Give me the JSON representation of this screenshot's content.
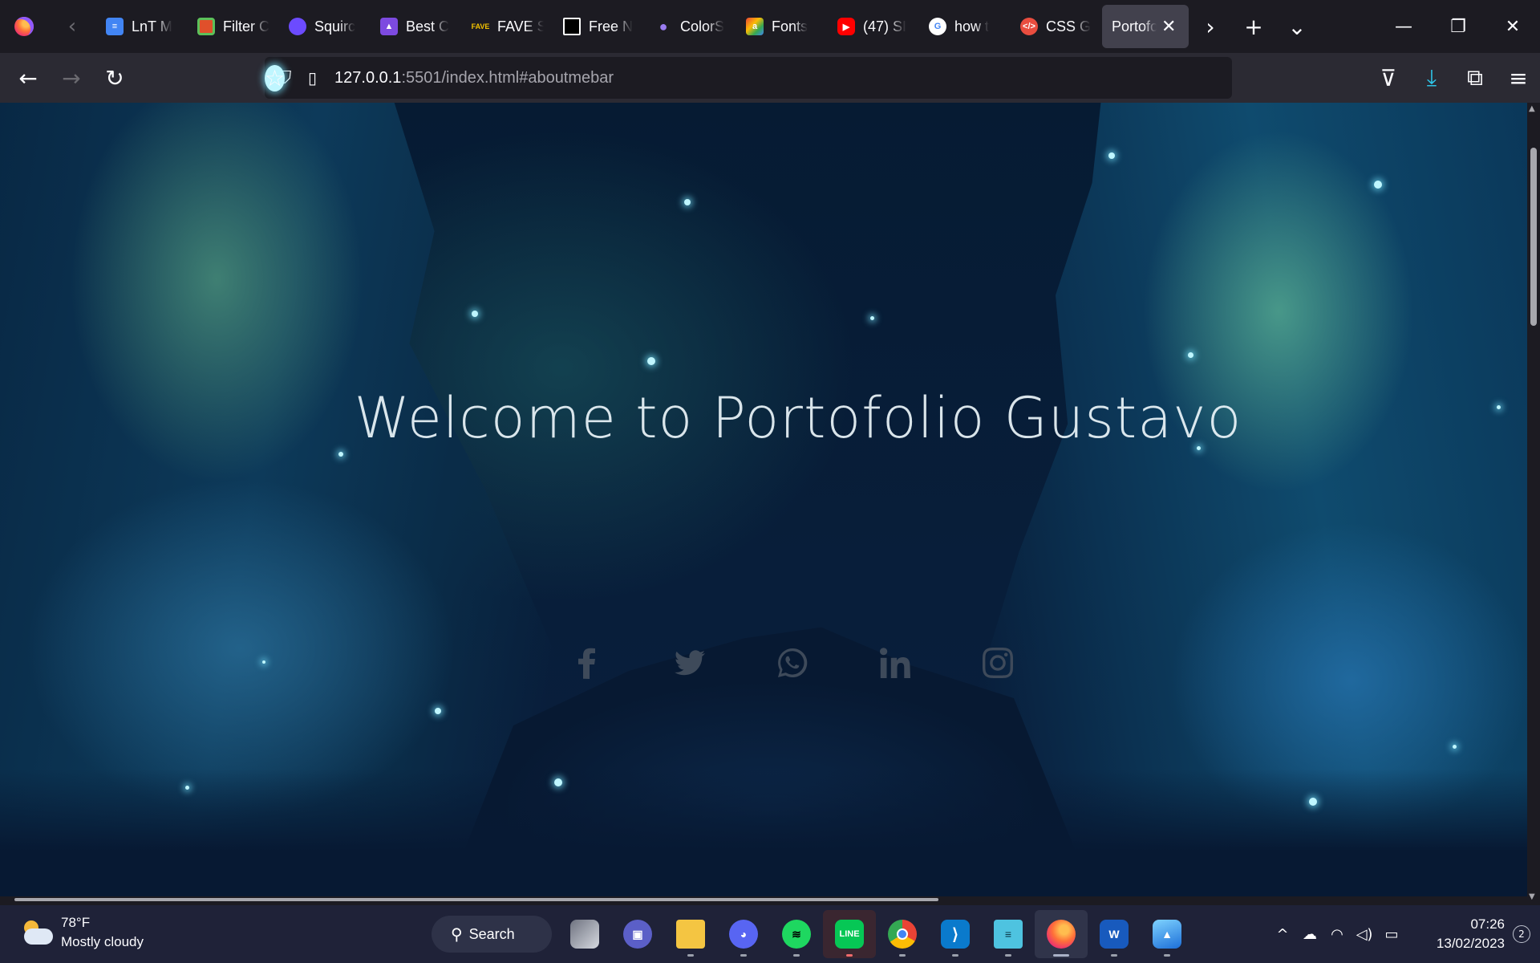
{
  "browser": {
    "tabs": [
      {
        "title": "LnT M",
        "icon": "docs-icon",
        "color": "#4285f4"
      },
      {
        "title": "Filter C",
        "icon": "filter-icon",
        "color": "#e0502b"
      },
      {
        "title": "Squirc",
        "icon": "squircle-icon",
        "color": "#6c4bff"
      },
      {
        "title": "Best C",
        "icon": "rocket-icon",
        "color": "#7d4ae0"
      },
      {
        "title": "FAVE S",
        "icon": "fave-icon",
        "color": "#d8a100"
      },
      {
        "title": "Free N",
        "icon": "free-icon",
        "color": "#111111"
      },
      {
        "title": "ColorS",
        "icon": "planet-icon",
        "color": "#8a6be0"
      },
      {
        "title": "Fonts",
        "icon": "fonts-icon",
        "color": "#34a853"
      },
      {
        "title": "(47) SI",
        "icon": "youtube-icon",
        "color": "#ff0000"
      },
      {
        "title": "how t",
        "icon": "google-icon",
        "color": "#ffffff"
      },
      {
        "title": "CSS G",
        "icon": "code-icon",
        "color": "#e94d3f"
      },
      {
        "title": "Portofol",
        "icon": "none",
        "color": "#42414d",
        "active": true
      }
    ],
    "url_host": "127.0.0.1",
    "url_rest": ":5501/index.html#aboutmebar"
  },
  "page": {
    "title": "Welcome to Portofolio Gustavo",
    "socials": [
      "facebook-icon",
      "twitter-icon",
      "whatsapp-icon",
      "linkedin-icon",
      "instagram-icon"
    ]
  },
  "taskbar": {
    "weather_temp": "78°F",
    "weather_desc": "Mostly cloudy",
    "search_label": "Search",
    "time": "07:26",
    "date": "13/02/2023",
    "notifications": "2"
  }
}
